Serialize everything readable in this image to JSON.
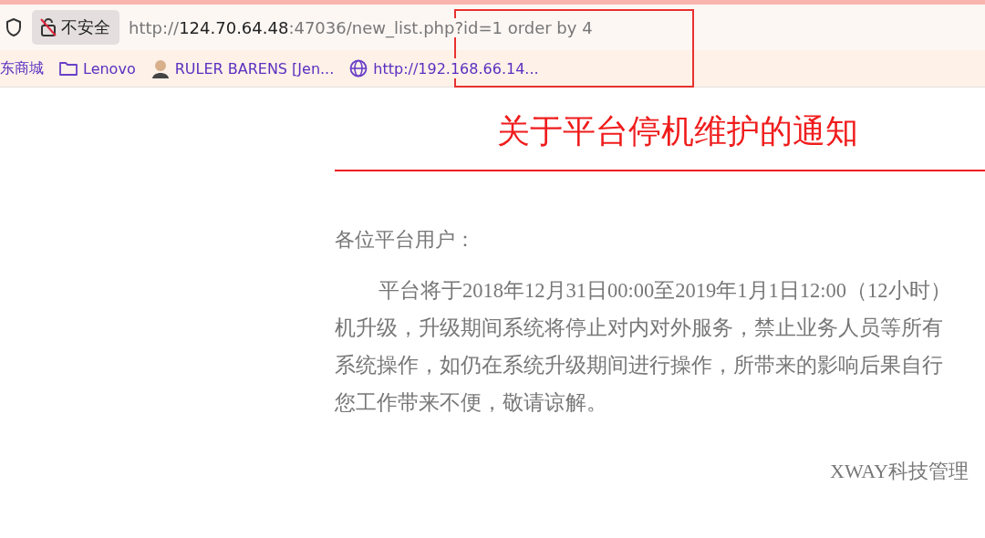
{
  "address_bar": {
    "security_label": "不安全",
    "url_host_prefix": "http://",
    "url_host": "124.70.64.48",
    "url_rest": ":47036/new_list.php?id=1 order by 4"
  },
  "bookmarks": [
    {
      "kind": "text",
      "label": "东商城"
    },
    {
      "kind": "folder",
      "label": "Lenovo"
    },
    {
      "kind": "avatar",
      "label": "RULER BARENS [Jen..."
    },
    {
      "kind": "globe",
      "label": "http://192.168.66.14..."
    }
  ],
  "article": {
    "title": "关于平台停机维护的通知",
    "greeting": "各位平台用户：",
    "paragraph_lines": [
      {
        "indent": true,
        "text": "平台将于2018年12月31日00:00至2019年1月1日12:00（12小时）"
      },
      {
        "indent": false,
        "text": "机升级，升级期间系统将停止对内对外服务，禁止业务人员等所有"
      },
      {
        "indent": false,
        "text": "系统操作，如仍在系统升级期间进行操作，所带来的影响后果自行"
      },
      {
        "indent": false,
        "text": "您工作带来不便，敬请谅解。"
      }
    ],
    "signature": "XWAY科技管理"
  }
}
